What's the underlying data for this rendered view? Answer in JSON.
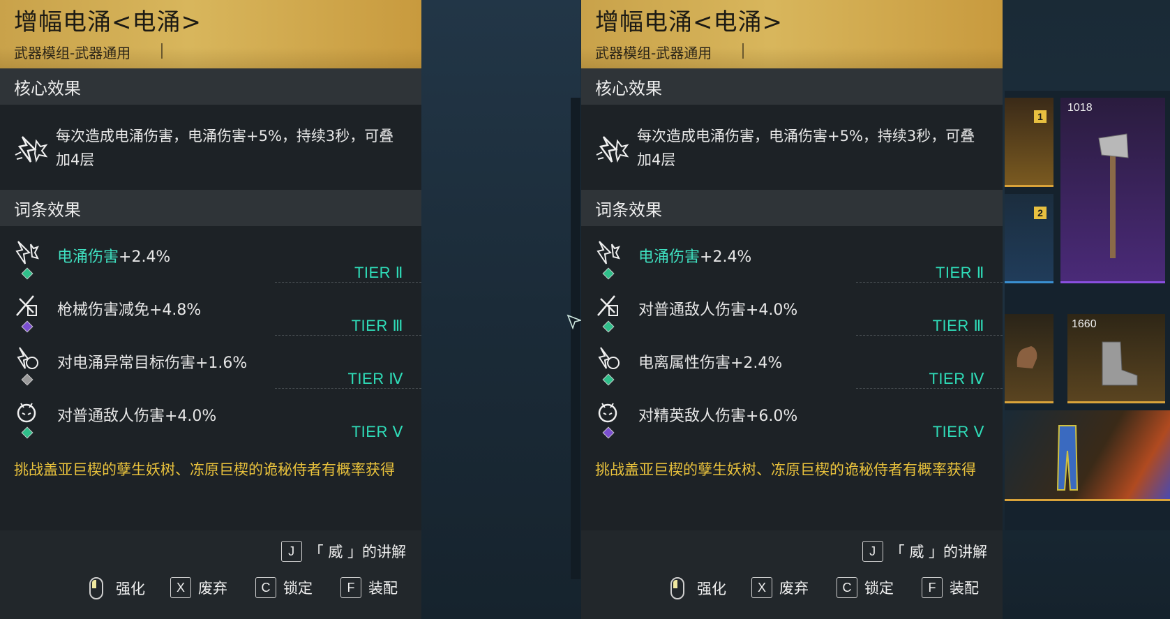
{
  "panels": [
    {
      "title": "增幅电涌<电涌>",
      "subtitle": "武器模组-武器通用",
      "core_header": "核心效果",
      "core_text": "每次造成电涌伤害，电涌伤害+5%，持续3秒，可叠加4层",
      "affix_header": "词条效果",
      "affixes": [
        {
          "hl": "电涌伤害",
          "text": "+2.4%",
          "tier": "TIER Ⅱ",
          "icon": "surge-icon",
          "gem": "#2fbf8a"
        },
        {
          "hl": "",
          "text": "枪械伤害减免+4.8%",
          "tier": "TIER Ⅲ",
          "icon": "gun-shield-icon",
          "gem": "#7b4fd0"
        },
        {
          "hl": "",
          "text": "对电涌异常目标伤害+1.6%",
          "tier": "TIER Ⅳ",
          "icon": "surge-target-icon",
          "gem": "#9a9a9a"
        },
        {
          "hl": "",
          "text": "对普通敌人伤害+4.0%",
          "tier": "TIER Ⅴ",
          "icon": "enemy-icon",
          "gem": "#2fbf8a"
        }
      ],
      "source": "挑战盖亚巨楔的孽生妖树、冻原巨楔的诡秘侍者有概率获得",
      "footer": {
        "explain_key": "J",
        "explain_label": "「 威 」的讲解",
        "enhance": "强化",
        "discard_key": "X",
        "discard": "废弃",
        "lock_key": "C",
        "lock": "锁定",
        "equip_key": "F",
        "equip": "装配"
      }
    },
    {
      "title": "增幅电涌<电涌>",
      "subtitle": "武器模组-武器通用",
      "core_header": "核心效果",
      "core_text": "每次造成电涌伤害，电涌伤害+5%，持续3秒，可叠加4层",
      "affix_header": "词条效果",
      "affixes": [
        {
          "hl": "电涌伤害",
          "text": "+2.4%",
          "tier": "TIER Ⅱ",
          "icon": "surge-icon",
          "gem": "#2fbf8a"
        },
        {
          "hl": "",
          "text": "对普通敌人伤害+4.0%",
          "tier": "TIER Ⅲ",
          "icon": "enemy-icon",
          "gem": "#2fbf8a"
        },
        {
          "hl": "",
          "text": "电离属性伤害+2.4%",
          "tier": "TIER Ⅳ",
          "icon": "lightning-icon",
          "gem": "#2fbf8a"
        },
        {
          "hl": "",
          "text": "对精英敌人伤害+6.0%",
          "tier": "TIER Ⅴ",
          "icon": "elite-icon",
          "gem": "#7b4fd0"
        }
      ],
      "source": "挑战盖亚巨楔的孽生妖树、冻原巨楔的诡秘侍者有概率获得",
      "footer": {
        "explain_key": "J",
        "explain_label": "「 威 」的讲解",
        "enhance": "强化",
        "discard_key": "X",
        "discard": "废弃",
        "lock_key": "C",
        "lock": "锁定",
        "equip_key": "F",
        "equip": "装配"
      }
    }
  ],
  "inventory": {
    "slot1_num": "1",
    "slot2_num": "2",
    "axe_value": "1018",
    "boots_value": "1660"
  }
}
